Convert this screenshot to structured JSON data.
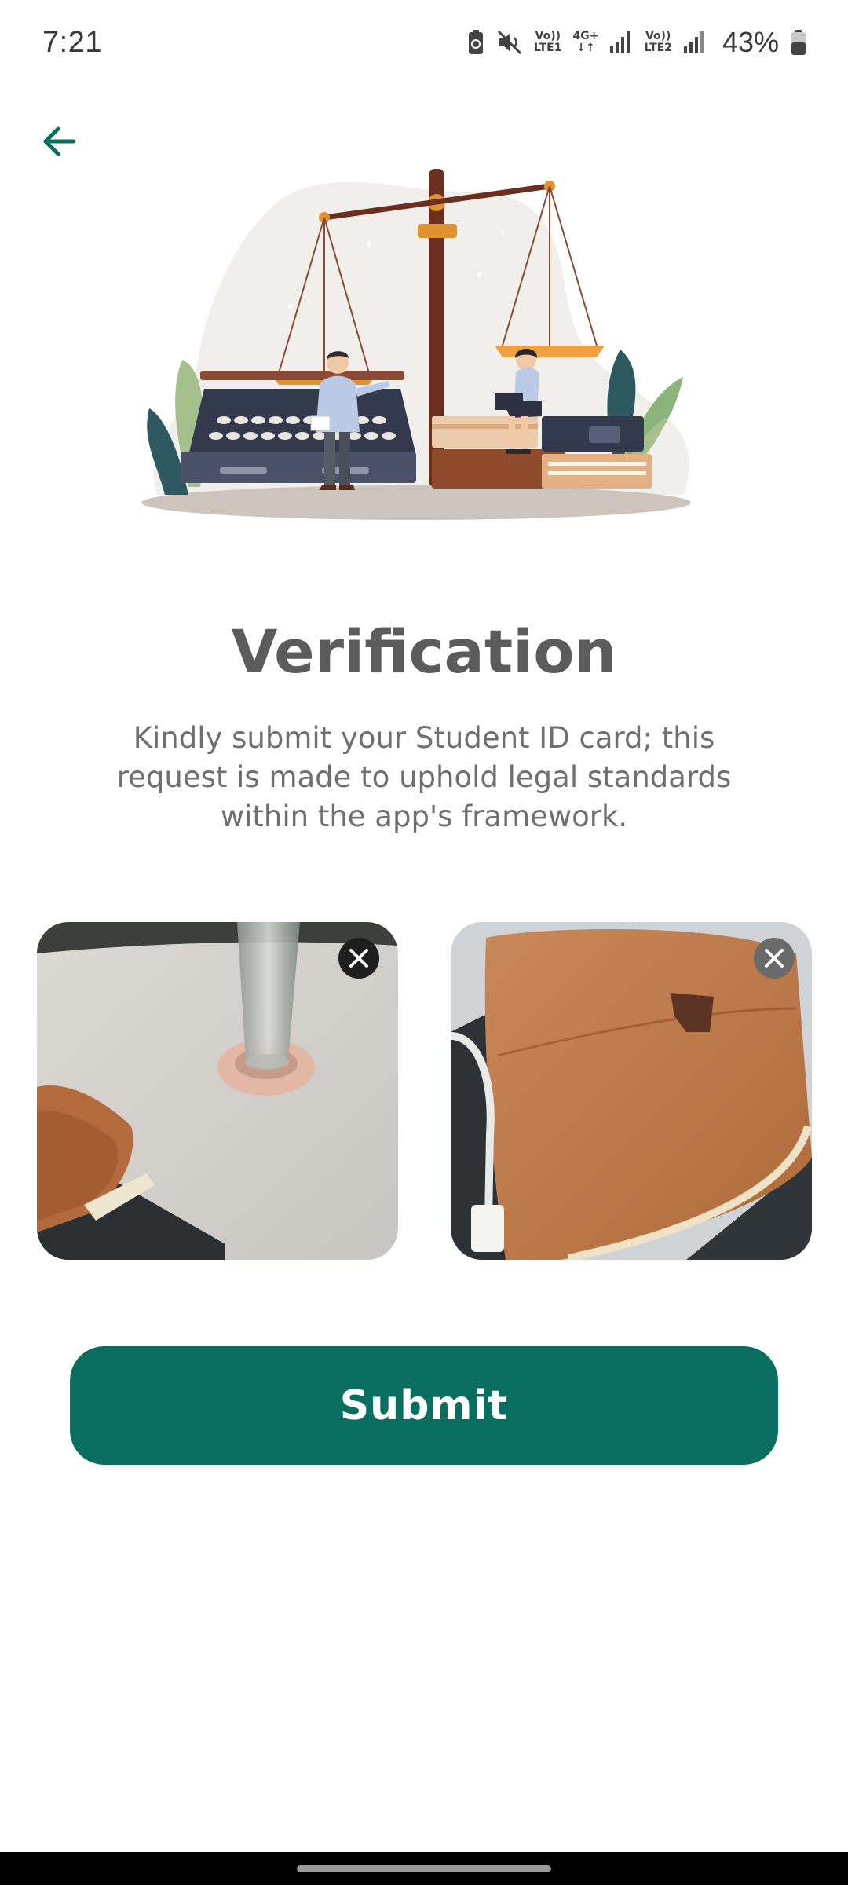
{
  "status_bar": {
    "time": "7:21",
    "sim1_label_top": "Vo))",
    "sim1_label_bottom": "LTE1",
    "net_label_top": "4G+",
    "net_label_bottom": "↓↑",
    "sim2_label_top": "Vo))",
    "sim2_label_bottom": "LTE2",
    "battery": "43%",
    "icons": [
      "battery-saver-icon",
      "mute-icon",
      "signal-icon",
      "battery-icon"
    ]
  },
  "header": {
    "back_icon": "arrow-left-icon"
  },
  "illustration": {
    "name": "legal-scales-illustration"
  },
  "main": {
    "title": "Verification",
    "description": "Kindly submit your Student ID card; this request is made to uphold legal standards within the app's framework.",
    "photos": [
      {
        "name": "uploaded-photo-front",
        "remove_icon": "close-icon"
      },
      {
        "name": "uploaded-photo-back",
        "remove_icon": "close-icon"
      }
    ],
    "submit_label": "Submit"
  },
  "colors": {
    "accent": "#096e5f",
    "title": "#5c5c5c",
    "description": "#6f6f6f"
  }
}
